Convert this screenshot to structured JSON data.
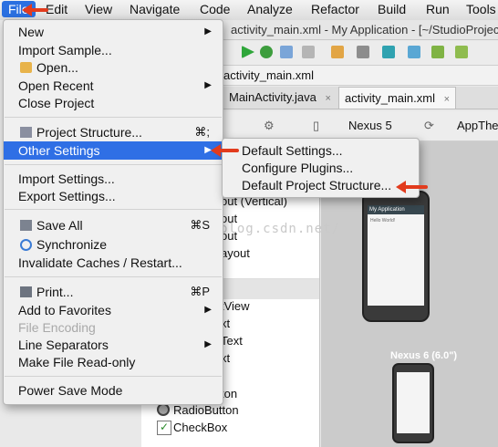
{
  "menubar": {
    "items": [
      "File",
      "Edit",
      "View",
      "Navigate",
      "Code",
      "Analyze",
      "Refactor",
      "Build",
      "Run",
      "Tools"
    ]
  },
  "window": {
    "title": "activity_main.xml - My Application - [~/StudioProjects/MyApplication]"
  },
  "breadcrumb": {
    "current": "activity_main.xml"
  },
  "editor_tabs": [
    {
      "label": "MainActivity.java",
      "close": "×"
    },
    {
      "label": "activity_main.xml",
      "close": "×"
    }
  ],
  "design_toolbar": {
    "device": "Nexus 5",
    "theme": "AppTheme"
  },
  "palette": {
    "items": [
      "out (Vertical)",
      "out",
      "out",
      "ayout",
      "tView",
      "xt",
      "Text",
      "xt",
      "ton",
      "RadioButton",
      "CheckBox"
    ]
  },
  "preview": {
    "phone_app_title": "My Application",
    "phone_content": "Hello World!",
    "device_label": "Nexus 6 (6.0\")"
  },
  "watermark": "http://blog.csdn.net/",
  "file_menu": {
    "items": [
      {
        "label": "New",
        "submenu": true
      },
      {
        "label": "Import Sample..."
      },
      {
        "label": "Open...",
        "icon": "folder-icon"
      },
      {
        "label": "Open Recent",
        "submenu": true
      },
      {
        "label": "Close Project"
      },
      {
        "label": "Project Structure...",
        "icon": "project-structure-icon",
        "shortcut": "⌘;"
      },
      {
        "label": "Other Settings",
        "submenu": true,
        "highlighted": true
      },
      {
        "label": "Import Settings..."
      },
      {
        "label": "Export Settings..."
      },
      {
        "label": "Save All",
        "icon": "save-icon",
        "shortcut": "⌘S"
      },
      {
        "label": "Synchronize",
        "icon": "sync-icon"
      },
      {
        "label": "Invalidate Caches / Restart..."
      },
      {
        "label": "Print...",
        "icon": "printer-icon",
        "shortcut": "⌘P"
      },
      {
        "label": "Add to Favorites",
        "submenu": true
      },
      {
        "label": "File Encoding",
        "disabled": true
      },
      {
        "label": "Line Separators",
        "submenu": true
      },
      {
        "label": "Make File Read-only"
      },
      {
        "label": "Power Save Mode"
      }
    ],
    "submenu_arrow": "▶"
  },
  "other_settings_submenu": {
    "items": [
      "Default Settings...",
      "Configure Plugins...",
      "Default Project Structure..."
    ]
  },
  "colors": {
    "highlight": "#2f6fe5",
    "annotation_arrow": "#e23b1d"
  }
}
